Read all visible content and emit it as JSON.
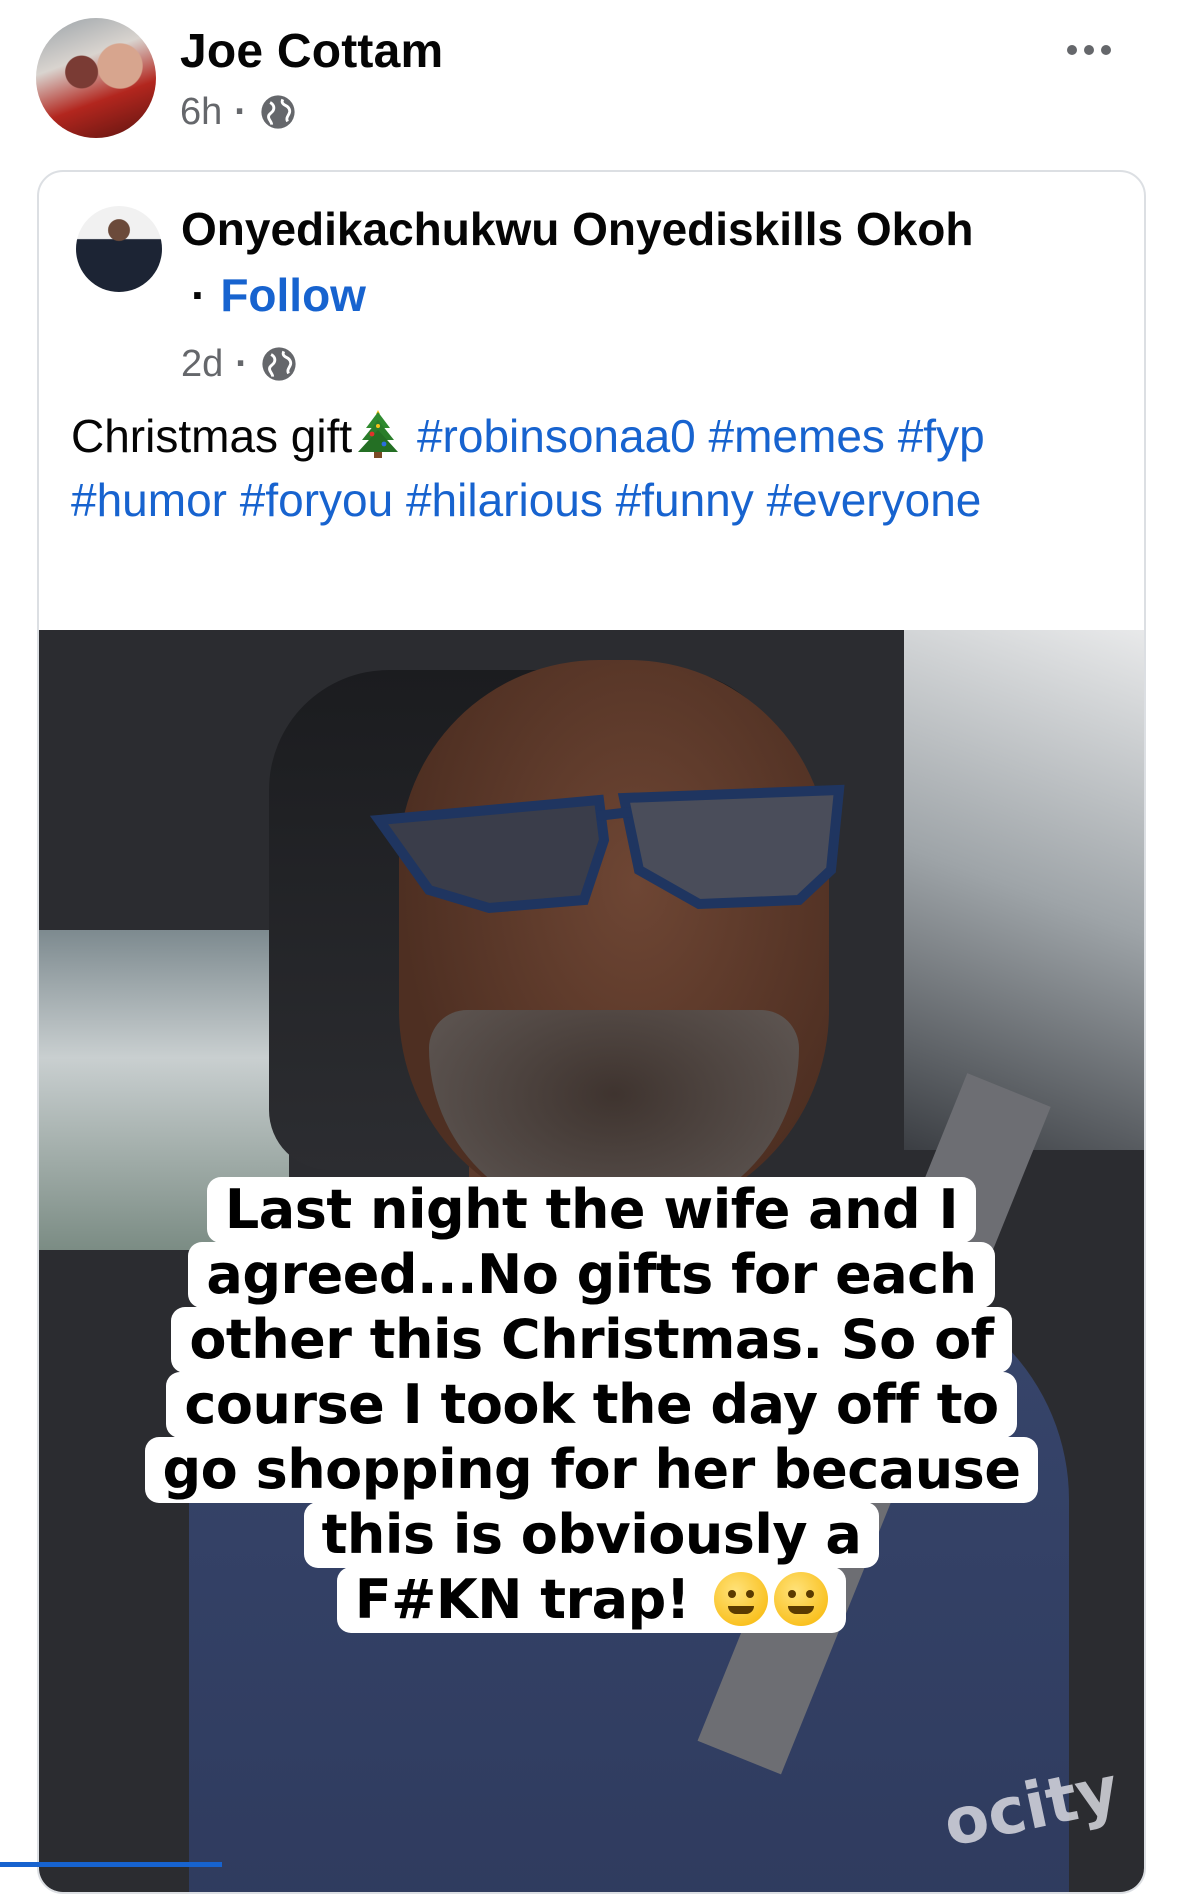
{
  "post": {
    "author": "Joe Cottam",
    "time": "6h",
    "privacy_icon": "globe-icon",
    "more_icon": "ellipsis-icon"
  },
  "shared": {
    "author": "Onyedikachukwu Onyediskills Okoh",
    "follow_label": "Follow",
    "time": "2d",
    "privacy_icon": "globe-icon",
    "text_prefix": "Christmas gift",
    "text_emoji": "christmas-tree-icon",
    "hashtags": [
      "#robinsonaa0",
      "#memes",
      "#fyp",
      "#humor",
      "#foryou",
      "#hilarious",
      "#funny",
      "#everyone"
    ]
  },
  "media": {
    "caption_lines": [
      "Last night the wife and I",
      "agreed...No gifts for each",
      "other this Christmas. So of",
      "course I took the day off to",
      "go shopping for her because",
      "this is obviously a",
      "F#KN trap!"
    ],
    "caption_emojis": [
      "woozy-face-icon",
      "grinning-squinting-face-icon"
    ],
    "watermark": "ocity"
  },
  "colors": {
    "link": "#1763cf",
    "meta": "#65676b",
    "text": "#050505"
  }
}
